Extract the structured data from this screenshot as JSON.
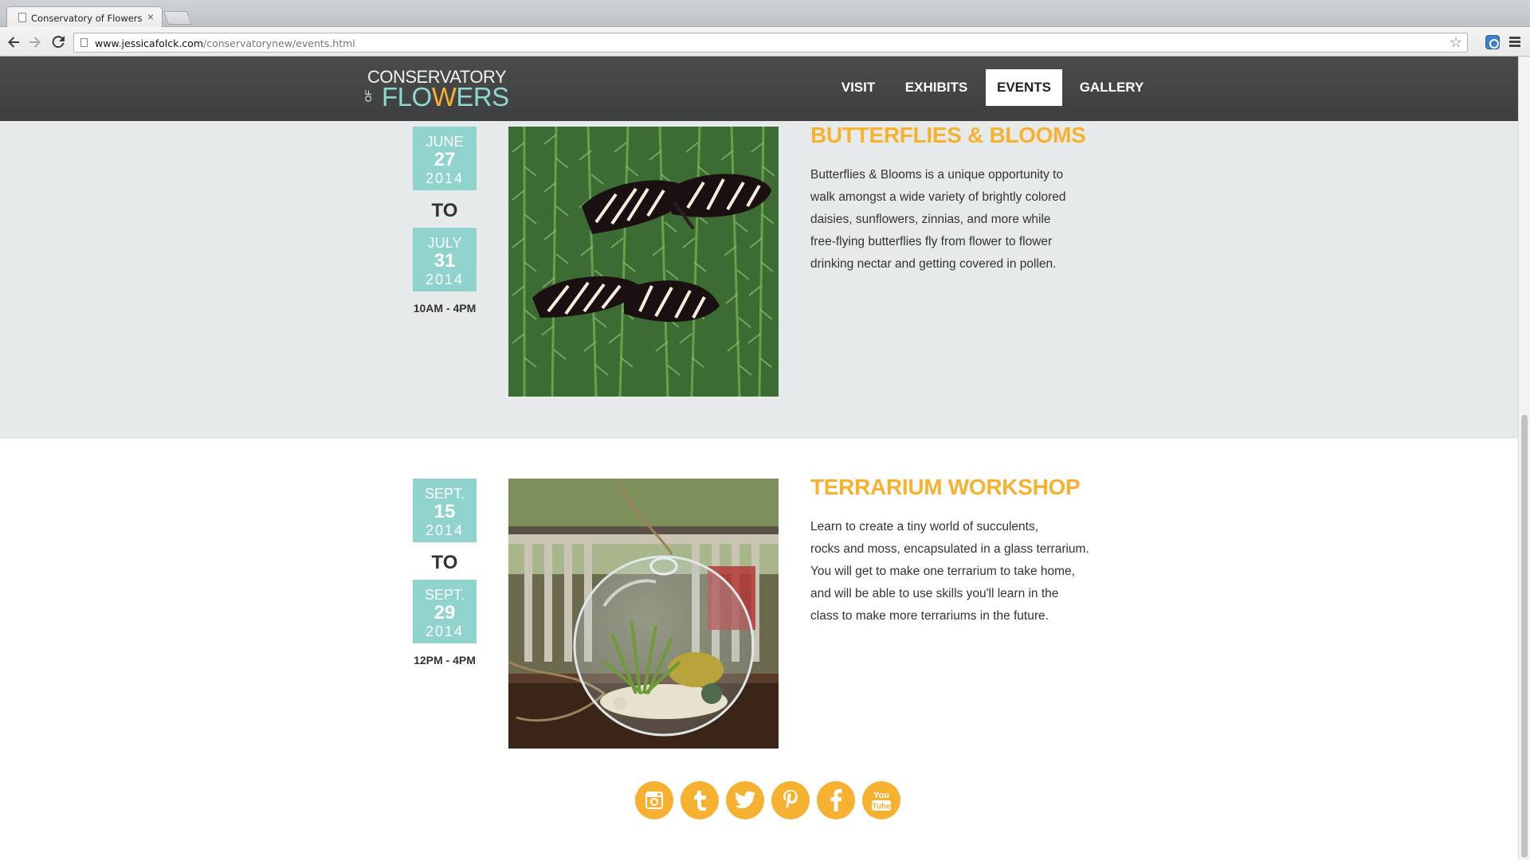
{
  "browser": {
    "tab_title": "Conservatory of Flowers",
    "tab_close": "×",
    "url_host": "www.jessicafolck.com",
    "url_path": "/conservatorynew/events.html"
  },
  "site": {
    "logo_line1": "CONSERVATORY",
    "logo_of": "OF",
    "logo_flo": "FLO",
    "logo_w": "W",
    "logo_ers": "ERS",
    "nav": {
      "visit": "VISIT",
      "exhibits": "EXHIBITS",
      "events": "EVENTS",
      "gallery": "GALLERY"
    },
    "active_nav": "EVENTS"
  },
  "events": [
    {
      "start": {
        "month": "JUNE",
        "day": "27",
        "year": "2014"
      },
      "to": "TO",
      "end": {
        "month": "JULY",
        "day": "31",
        "year": "2014"
      },
      "hours": "10AM - 4PM",
      "title": "BUTTERFLIES & BLOOMS",
      "description": [
        "Butterflies & Blooms is a unique opportunity to",
        "walk amongst a wide variety of brightly colored",
        "daisies, sunflowers, zinnias, and more while",
        "free-flying butterflies fly from flower to flower",
        "drinking nectar and getting covered in pollen."
      ],
      "image": "zebra-longwing-butterflies-on-fern"
    },
    {
      "start": {
        "month": "SEPT.",
        "day": "15",
        "year": "2014"
      },
      "to": "TO",
      "end": {
        "month": "SEPT.",
        "day": "29",
        "year": "2014"
      },
      "hours": "12PM - 4PM",
      "title": "TERRARIUM WORKSHOP",
      "description": [
        "Learn to create a tiny world of succulents,",
        "rocks and moss, encapsulated in a glass terrarium.",
        "You will get to make one terrarium to take home,",
        "and will be able to use skills you'll learn in the",
        "class to make more terrariums in the future."
      ],
      "image": "hanging-glass-terrarium"
    }
  ],
  "social": [
    "instagram-icon",
    "tumblr-icon",
    "twitter-icon",
    "pinterest-icon",
    "facebook-icon",
    "youtube-icon"
  ],
  "colors": {
    "accent_yellow": "#f7b131",
    "date_teal": "#8fd3cc",
    "header_dark": "#444545",
    "section_gray": "#e6eaea"
  }
}
